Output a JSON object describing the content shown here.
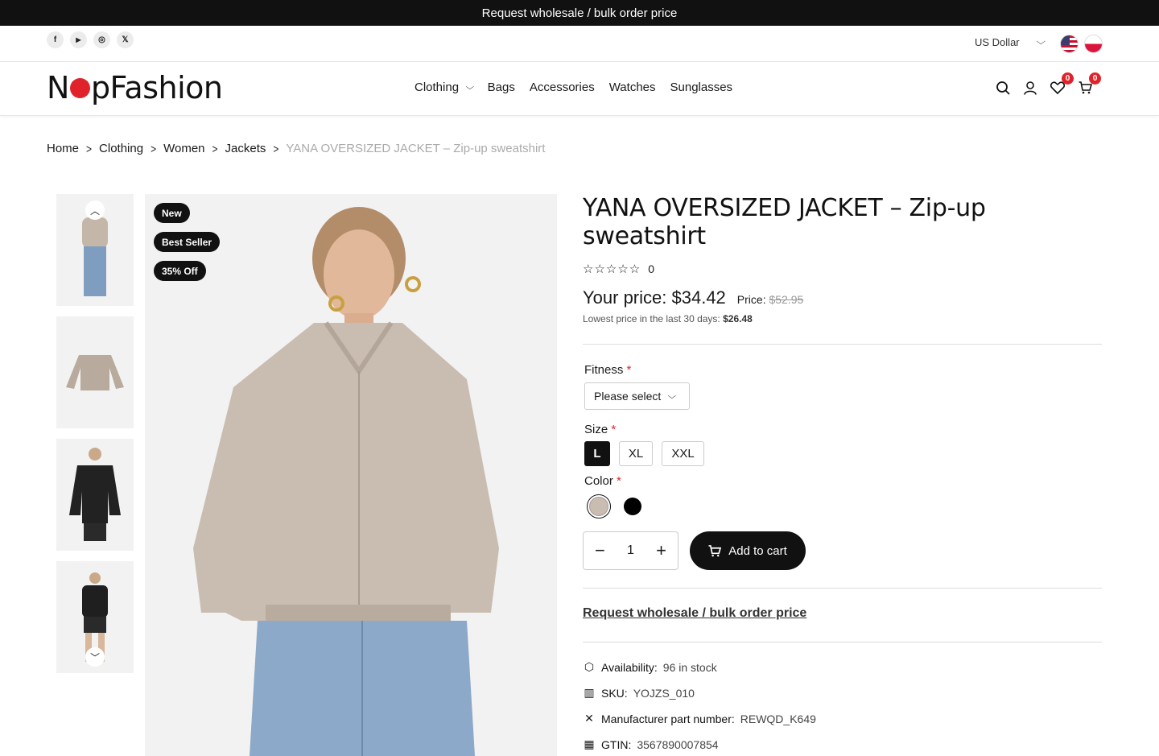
{
  "promo_bar": {
    "text": "Request wholesale / bulk order price"
  },
  "top_bar": {
    "socials": [
      "f",
      "▶",
      "◎",
      "𝕏"
    ],
    "currency": "US Dollar"
  },
  "header": {
    "logo_left": "N",
    "logo_right": "pFashion",
    "nav": [
      {
        "label": "Clothing",
        "has_dropdown": true
      },
      {
        "label": "Bags"
      },
      {
        "label": "Accessories"
      },
      {
        "label": "Watches"
      },
      {
        "label": "Sunglasses"
      }
    ],
    "wishlist_count": "0",
    "cart_count": "0"
  },
  "breadcrumb": [
    "Home",
    "Clothing",
    "Women",
    "Jackets"
  ],
  "breadcrumb_current": "YANA OVERSIZED JACKET – Zip-up sweatshirt",
  "gallery": {
    "tags": [
      "New",
      "Best Seller",
      "35% Off"
    ]
  },
  "product": {
    "title": "YANA OVERSIZED JACKET – Zip-up sweatshirt",
    "rating_stars": "☆☆☆☆☆",
    "review_count": "0",
    "your_price_label": "Your price:",
    "your_price": "$34.42",
    "old_price_label": "Price:",
    "old_price": "$52.95",
    "lowest_label": "Lowest price in the last 30 days:",
    "lowest_value": "$26.48",
    "fitness_label": "Fitness",
    "fitness_placeholder": "Please select",
    "size_label": "Size",
    "sizes": [
      "L",
      "XL",
      "XXL"
    ],
    "selected_size": "L",
    "color_label": "Color",
    "colors": [
      "#c9bdb2",
      "#000000"
    ],
    "quantity": "1",
    "add_to_cart": "Add to cart",
    "wholesale_link": "Request wholesale / bulk order price",
    "specs": [
      {
        "icon": "box-icon",
        "key": "Availability:",
        "value": "96 in stock"
      },
      {
        "icon": "barcode-icon",
        "key": "SKU:",
        "value": "YOJZS_010"
      },
      {
        "icon": "tools-icon",
        "key": "Manufacturer part number:",
        "value": "REWQD_K649"
      },
      {
        "icon": "qr-icon",
        "key": "GTIN:",
        "value": "3567890007854"
      }
    ]
  },
  "colors": {
    "accent": "#e0232b",
    "dark": "#111111"
  }
}
